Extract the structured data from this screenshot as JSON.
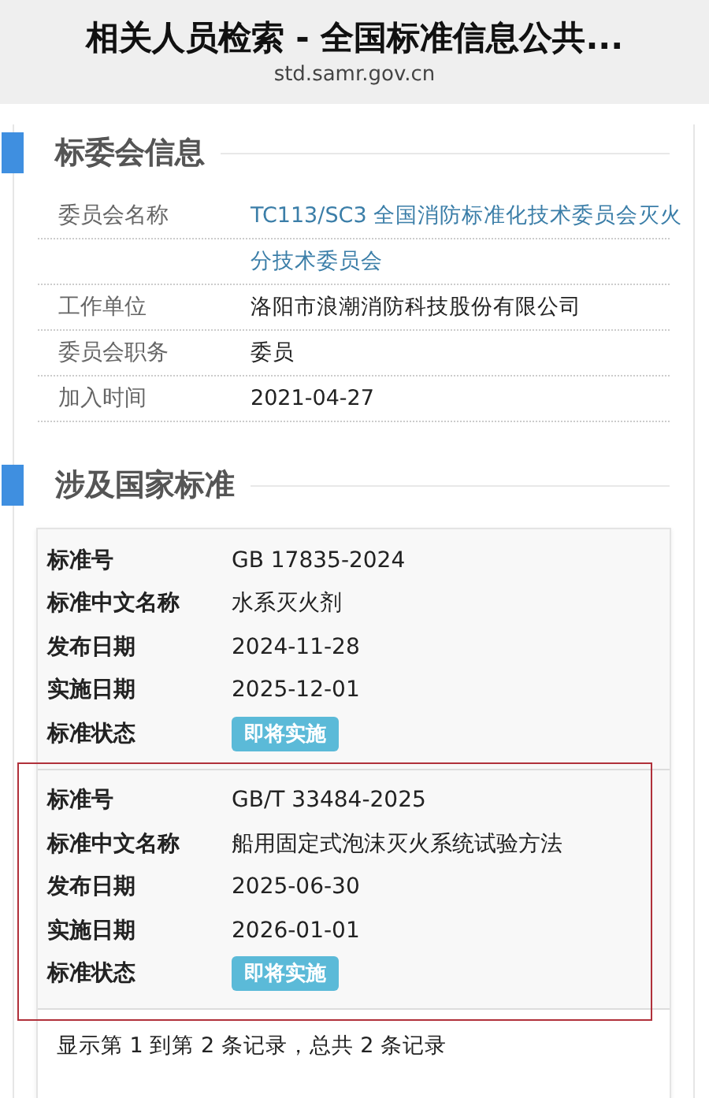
{
  "header": {
    "title": "相关人员检索 - 全国标准信息公共...",
    "url": "std.samr.gov.cn"
  },
  "committee_section": {
    "title": "标委会信息",
    "fields": [
      {
        "label": "委员会名称",
        "link": true,
        "lines": [
          "TC113/SC3  全国消防标准化技术委员会灭火",
          "分技术委员会"
        ]
      },
      {
        "label": "工作单位",
        "link": false,
        "lines": [
          "洛阳市浪潮消防科技股份有限公司"
        ]
      },
      {
        "label": "委员会职务",
        "link": false,
        "lines": [
          "委员"
        ]
      },
      {
        "label": "加入时间",
        "link": false,
        "lines": [
          "2021-04-27"
        ]
      }
    ]
  },
  "standards_section": {
    "title": "涉及国家标准",
    "records": [
      {
        "highlighted": false,
        "fields": [
          {
            "kind": "link",
            "label": "标准号",
            "value": "GB 17835-2024"
          },
          {
            "kind": "text",
            "label": "标准中文名称",
            "value": "水系灭火剂"
          },
          {
            "kind": "text",
            "label": "发布日期",
            "value": "2024-11-28"
          },
          {
            "kind": "text",
            "label": "实施日期",
            "value": "2025-12-01"
          },
          {
            "kind": "badge",
            "label": "标准状态",
            "value": "即将实施"
          }
        ]
      },
      {
        "highlighted": true,
        "fields": [
          {
            "kind": "link",
            "label": "标准号",
            "value": "GB/T 33484-2025"
          },
          {
            "kind": "text",
            "label": "标准中文名称",
            "value": "船用固定式泡沫灭火系统试验方法"
          },
          {
            "kind": "text",
            "label": "发布日期",
            "value": "2025-06-30"
          },
          {
            "kind": "text",
            "label": "实施日期",
            "value": "2026-01-01"
          },
          {
            "kind": "badge",
            "label": "标准状态",
            "value": "即将实施"
          }
        ]
      }
    ],
    "pagination": "显示第 1 到第 2 条记录，总共 2 条记录"
  }
}
